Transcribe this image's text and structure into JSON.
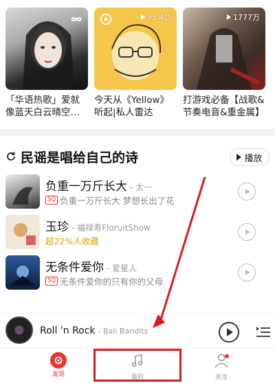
{
  "cards": [
    {
      "title": "「华语热歌」爱就像蓝天白云晴空…",
      "badge": ""
    },
    {
      "title": "今天从《Yellow》听起|私人雷达",
      "badge": "93.4亿"
    },
    {
      "title": "打游戏必备【战歌&节奏电音&重金属】",
      "badge": "1777万"
    }
  ],
  "section": {
    "title": "民谣是唱给自己的诗",
    "play_all": "播放"
  },
  "songs": [
    {
      "title": "负重一万斤长大",
      "artist": "- 太一",
      "tag": "SQ",
      "sub": "负重一万斤长大 梦想长出了花"
    },
    {
      "title": "玉珍",
      "artist": "- 福禄寿FloruitShow",
      "tag": "",
      "sub": "超22%人收藏"
    },
    {
      "title": "无条件爱你",
      "artist": "- 爱星人",
      "tag": "SQ",
      "sub": "无条件爱你的只有你的父母"
    }
  ],
  "mini_player": {
    "title": "Roll 'n Rock",
    "artist": "- Bali Bandits"
  },
  "tabs": [
    {
      "label": "发现",
      "icon": "discover-icon"
    },
    {
      "label": "我的",
      "icon": "music-note-icon"
    },
    {
      "label": "关注",
      "icon": "user-icon"
    }
  ],
  "colors": {
    "accent": "#e33333",
    "annotation": "#e0161d"
  }
}
